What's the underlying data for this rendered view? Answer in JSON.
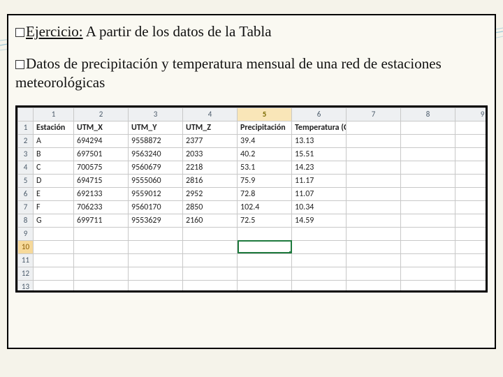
{
  "heading": {
    "label": "Ejercicio:",
    "rest": " A partir de los datos de la Tabla"
  },
  "subheading": "Datos de precipitación y temperatura mensual de una red de estaciones meteorológicas",
  "sheet": {
    "col_headers": [
      "1",
      "2",
      "3",
      "4",
      "5",
      "6",
      "7",
      "8",
      "9"
    ],
    "selected_col_index": 4,
    "row_headers": [
      "1",
      "2",
      "3",
      "4",
      "5",
      "6",
      "7",
      "8",
      "9",
      "10",
      "11",
      "12",
      "13"
    ],
    "selected_row_index": 9,
    "data_headers": [
      "Estación",
      "UTM_X",
      "UTM_Y",
      "UTM_Z",
      "Precipitación",
      "Temperatura (C°)"
    ],
    "rows": [
      {
        "est": "A",
        "x": "694294",
        "y": "9558872",
        "z": "2377",
        "p": "39.4",
        "t": "13.13"
      },
      {
        "est": "B",
        "x": "697501",
        "y": "9563240",
        "z": "2033",
        "p": "40.2",
        "t": "15.51"
      },
      {
        "est": "C",
        "x": "700575",
        "y": "9560679",
        "z": "2218",
        "p": "53.1",
        "t": "14.23"
      },
      {
        "est": "D",
        "x": "694715",
        "y": "9555060",
        "z": "2816",
        "p": "75.9",
        "t": "11.17"
      },
      {
        "est": "E",
        "x": "692133",
        "y": "9559012",
        "z": "2952",
        "p": "72.8",
        "t": "11.07"
      },
      {
        "est": "F",
        "x": "706233",
        "y": "9560170",
        "z": "2850",
        "p": "102.4",
        "t": "10.34"
      },
      {
        "est": "G",
        "x": "699711",
        "y": "9553629",
        "z": "2160",
        "p": "72.5",
        "t": "14.59"
      }
    ],
    "active_cell": {
      "row": 10,
      "col": 5
    }
  }
}
